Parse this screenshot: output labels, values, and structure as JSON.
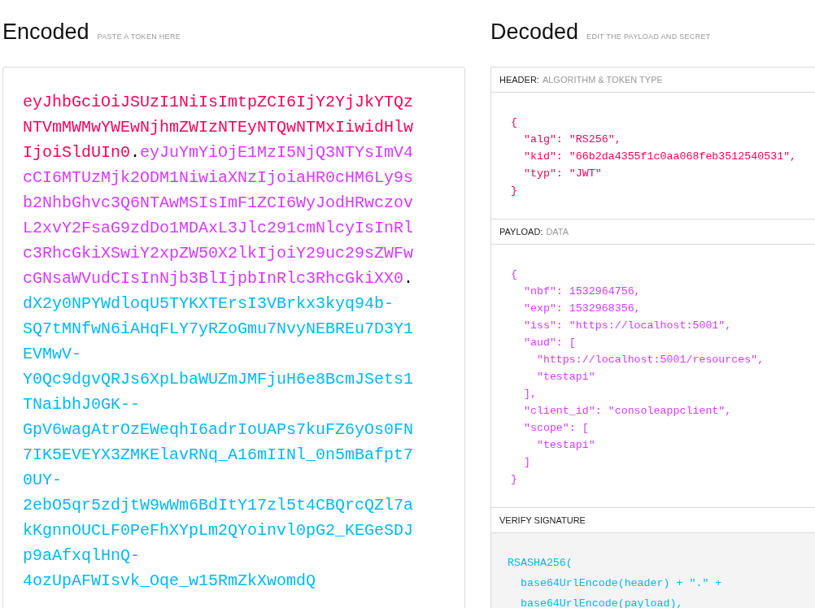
{
  "encoded": {
    "title": "Encoded",
    "subtitle": "PASTE A TOKEN HERE",
    "lines": [
      [
        {
          "kind": "header",
          "text": "eyJhbGciOiJSUzI1NiIsImtpZCI6IjY2YjJkYTQz"
        }
      ],
      [
        {
          "kind": "header",
          "text": "NTVmMWMwYWEwNjhmZWIzNTEyNTQwNTMxIiwidHlw"
        }
      ],
      [
        {
          "kind": "header",
          "text": "IjoiSldUIn0"
        },
        {
          "kind": "dot",
          "text": "."
        },
        {
          "kind": "payload",
          "text": "eyJuYmYiOjE1MzI5NjQ3NTYsImV4"
        }
      ],
      [
        {
          "kind": "payload",
          "text": "cCI6MTUzMjk2ODM1NiwiaXNzIjoiaHR0cHM6Ly9s"
        }
      ],
      [
        {
          "kind": "payload",
          "text": "b2NhbGhvc3Q6NTAwMSIsImF1ZCI6WyJodHRwczov"
        }
      ],
      [
        {
          "kind": "payload",
          "text": "L2xvY2FsaG9zdDo1MDAxL3Jlc291cmNlcyIsInRl"
        }
      ],
      [
        {
          "kind": "payload",
          "text": "c3RhcGkiXSwiY2xpZW50X2lkIjoiY29uc29sZWFw"
        }
      ],
      [
        {
          "kind": "payload",
          "text": "cGNsaWVudCIsInNjb3BlIjpbInRlc3RhcGkiXX0"
        },
        {
          "kind": "dot",
          "text": "."
        }
      ],
      [
        {
          "kind": "signature",
          "text": "dX2y0NPYWdloqU5TYKXTErsI3VBrkx3kyq94b-"
        }
      ],
      [
        {
          "kind": "signature",
          "text": "SQ7tMNfwN6iAHqFLY7yRZoGmu7NvyNEBREu7D3Y1"
        }
      ],
      [
        {
          "kind": "signature",
          "text": "EVMwV-"
        }
      ],
      [
        {
          "kind": "signature",
          "text": "Y0Qc9dgvQRJs6XpLbaWUZmJMFjuH6e8BcmJSets1"
        }
      ],
      [
        {
          "kind": "signature",
          "text": "TNaibhJ0GK--"
        }
      ],
      [
        {
          "kind": "signature",
          "text": "GpV6wagAtrOzEWeqhI6adrIoUAPs7kuFZ6yOs0FN"
        }
      ],
      [
        {
          "kind": "signature",
          "text": "7IK5EVEYX3ZMKElavRNq_A16mIINl_0n5mBafpt7"
        }
      ],
      [
        {
          "kind": "signature",
          "text": "0UY-"
        }
      ],
      [
        {
          "kind": "signature",
          "text": "2ebO5qr5zdjtW9wWm6BdItY17zl5t4CBQrcQZl7a"
        }
      ],
      [
        {
          "kind": "signature",
          "text": "kKgnnOUCLF0PeFhXYpLm2QYoinvl0pG2_KEGeSDJ"
        }
      ],
      [
        {
          "kind": "signature",
          "text": "p9aAfxqlHnQ-"
        }
      ],
      [
        {
          "kind": "signature",
          "text": "4ozUpAFWIsvk_Oqe_w15RmZkXwomdQ"
        }
      ]
    ]
  },
  "decoded": {
    "title": "Decoded",
    "subtitle": "EDIT THE PAYLOAD AND SECRET",
    "sections": [
      {
        "kind": "header",
        "label": "HEADER:",
        "sublabel": "ALGORITHM & TOKEN TYPE",
        "lines": [
          "{",
          "  \"alg\": \"RS256\",",
          "  \"kid\": \"66b2da4355f1c0aa068feb3512540531\",",
          "  \"typ\": \"JWT\"",
          "}"
        ]
      },
      {
        "kind": "payload",
        "label": "PAYLOAD:",
        "sublabel": "DATA",
        "lines": [
          "{",
          "  \"nbf\": 1532964756,",
          "  \"exp\": 1532968356,",
          "  \"iss\": \"https://localhost:5001\",",
          "  \"aud\": [",
          "    \"https://localhost:5001/resources\",",
          "    \"testapi\"",
          "  ],",
          "  \"client_id\": \"consoleappclient\",",
          "  \"scope\": [",
          "    \"testapi\"",
          "  ]",
          "}"
        ]
      },
      {
        "kind": "signature",
        "label": "VERIFY SIGNATURE",
        "lines": [
          "RSASHA256(",
          "  base64UrlEncode(header) + \".\" +",
          "  base64UrlEncode(payload),"
        ]
      }
    ]
  }
}
